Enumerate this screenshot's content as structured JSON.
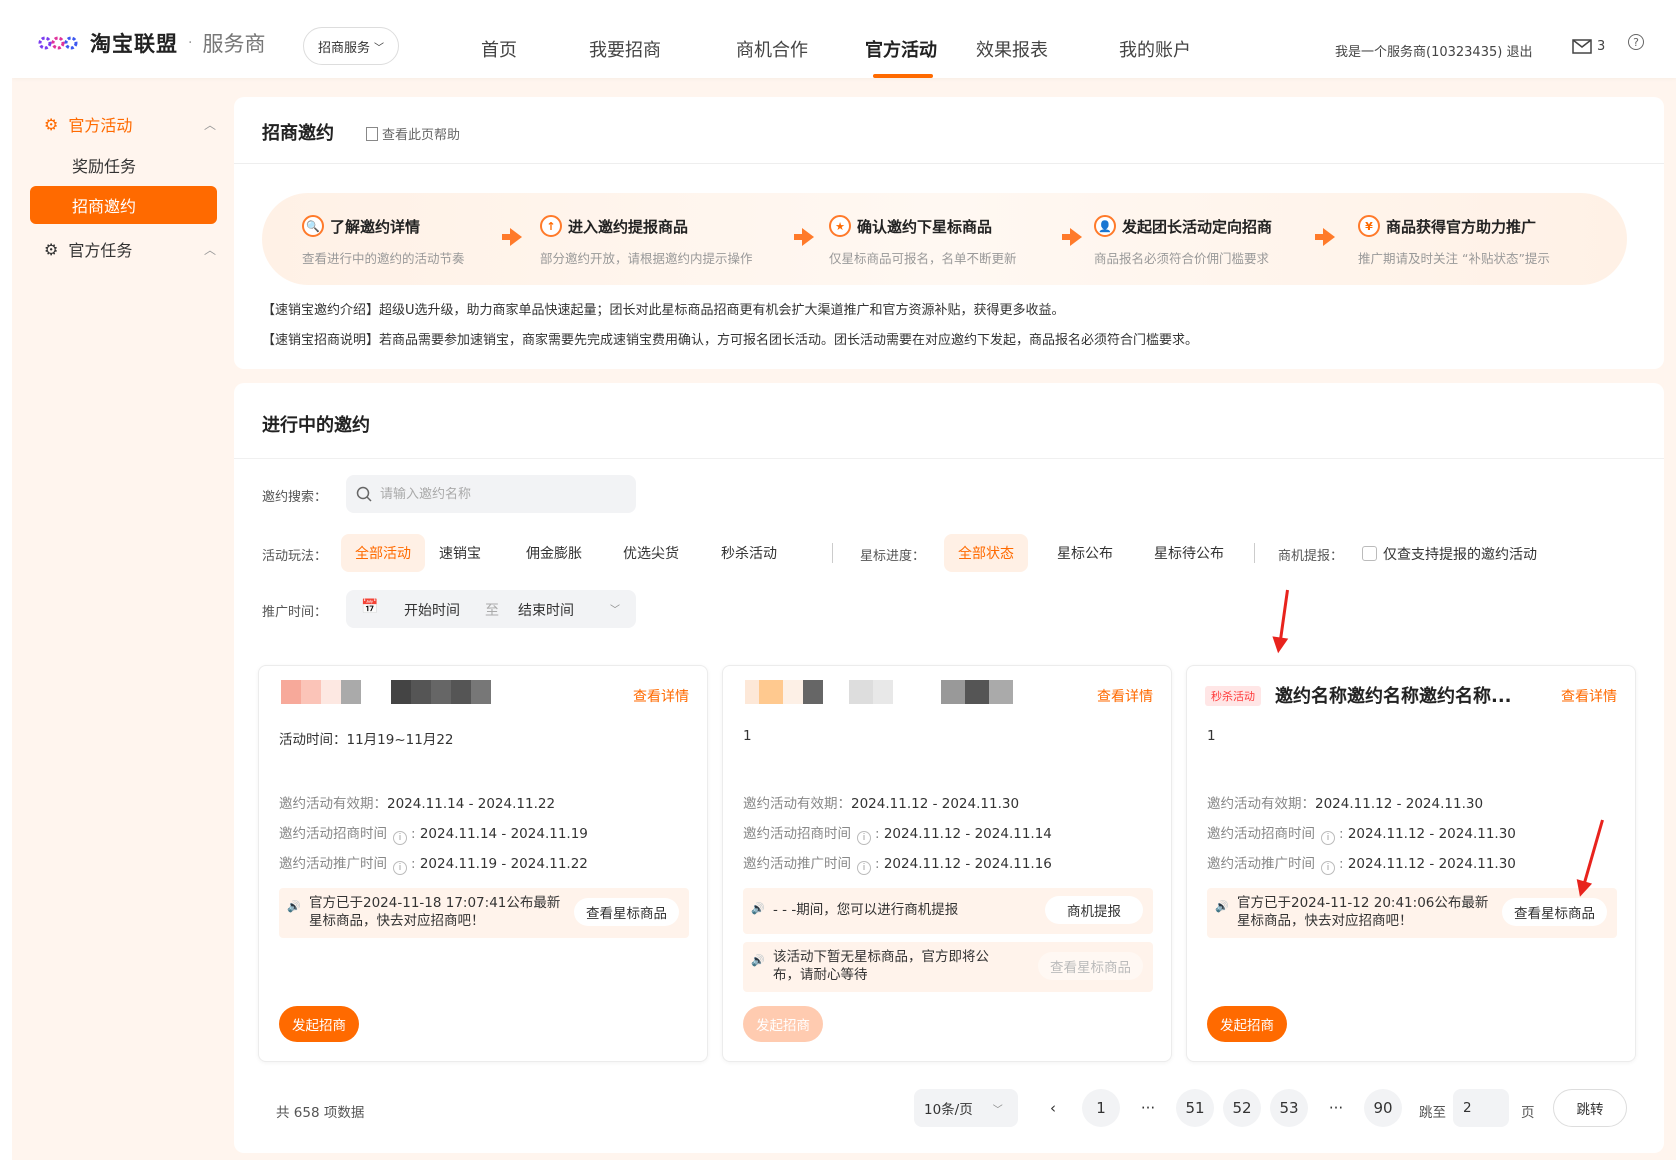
{
  "header": {
    "brand": "淘宝联盟",
    "separator": "·",
    "sub_brand": "服务商",
    "service_select": "招商服务",
    "nav": [
      "首页",
      "我要招商",
      "商机合作",
      "官方活动",
      "效果报表",
      "我的账户"
    ],
    "active_nav_index": 3,
    "user_text": "我是一个服务商(10323435) 退出",
    "mail_count": "3",
    "help": "?"
  },
  "sidebar": {
    "group1": "官方活动",
    "items": [
      "奖励任务",
      "招商邀约"
    ],
    "active_item_index": 1,
    "group2": "官方任务"
  },
  "intro_panel": {
    "title": "招商邀约",
    "help_link": "查看此页帮助",
    "steps": [
      {
        "title": "了解邀约详情",
        "desc": "查看进行中的邀约的活动节奏"
      },
      {
        "title": "进入邀约提报商品",
        "desc": "部分邀约开放，请根据邀约内提示操作"
      },
      {
        "title": "确认邀约下星标商品",
        "desc": "仅星标商品可报名，名单不断更新"
      },
      {
        "title": "发起团长活动定向招商",
        "desc": "商品报名必须符合价佣门槛要求"
      },
      {
        "title": "商品获得官方助力推广",
        "desc": "推广期请及时关注 “补贴状态”提示"
      }
    ],
    "intro1": "【速销宝邀约介绍】超级U选升级，助力商家单品快速起量；团长对此星标商品招商更有机会扩大渠道推广和官方资源补贴，获得更多收益。",
    "intro2": "【速销宝招商说明】若商品需要参加速销宝，商家需要先完成速销宝费用确认，方可报名团长活动。团长活动需要在对应邀约下发起，商品报名必须符合门槛要求。"
  },
  "list_panel": {
    "title": "进行中的邀约",
    "search_label": "邀约搜索：",
    "search_placeholder": "请输入邀约名称",
    "play_label": "活动玩法：",
    "play_options": [
      "全部活动",
      "速销宝",
      "佣金膨胀",
      "优选尖货",
      "秒杀活动"
    ],
    "star_label": "星标进度：",
    "star_options": [
      "全部状态",
      "星标公布",
      "星标待公布"
    ],
    "biz_label": "商机提报：",
    "biz_checkbox": "仅查支持提报的邀约活动",
    "time_label": "推广时间：",
    "start_time": "开始时间",
    "to": "至",
    "end_time": "结束时间"
  },
  "cards": [
    {
      "detail": "查看详情",
      "line1": "活动时间：11月19~11月22",
      "valid_label": "邀约活动有效期：",
      "valid": "2024.11.14 - 2024.11.22",
      "recruit_label": "邀约活动招商时间",
      "recruit": "2024.11.14 - 2024.11.19",
      "promo_label": "邀约活动推广时间",
      "promo": "2024.11.19 - 2024.11.22",
      "notice": "官方已于2024-11-18 17:07:41公布最新",
      "notice2": "星标商品，快去对应招商吧！",
      "notice_btn": "查看星标商品",
      "launch": "发起招商"
    },
    {
      "detail": "查看详情",
      "line1": "1",
      "valid_label": "邀约活动有效期：",
      "valid": "2024.11.12 - 2024.11.30",
      "recruit_label": "邀约活动招商时间",
      "recruit": "2024.11.12 - 2024.11.14",
      "promo_label": "邀约活动推广时间",
      "promo": "2024.11.12 - 2024.11.16",
      "notice": "- - -期间，您可以进行商机提报",
      "notice_btn": "商机提报",
      "notice_b": "该活动下暂无星标商品，官方即将公",
      "notice_b2": "布，请耐心等待",
      "notice_b_btn": "查看星标商品",
      "launch": "发起招商"
    },
    {
      "tag": "秒杀活动",
      "title": "邀约名称邀约名称邀约名称...",
      "detail": "查看详情",
      "line1": "1",
      "valid_label": "邀约活动有效期：",
      "valid": "2024.11.12 - 2024.11.30",
      "recruit_label": "邀约活动招商时间",
      "recruit": "2024.11.12 - 2024.11.30",
      "promo_label": "邀约活动推广时间",
      "promo": "2024.11.12 - 2024.11.30",
      "notice": "官方已于2024-11-12 20:41:06公布最新",
      "notice2": "星标商品，快去对应招商吧！",
      "notice_btn": "查看星标商品",
      "launch": "发起招商"
    }
  ],
  "pagination": {
    "total": "共 658 项数据",
    "page_size": "10条/页",
    "prev": "‹",
    "pages": [
      "1",
      "···",
      "51",
      "52",
      "53",
      "···",
      "90"
    ],
    "jump_to": "跳至",
    "jump_value": "2",
    "page_unit": "页",
    "jump_btn": "跳转"
  },
  "colors": {
    "accent": "#ff6a00",
    "annotation": "#e8231d"
  }
}
